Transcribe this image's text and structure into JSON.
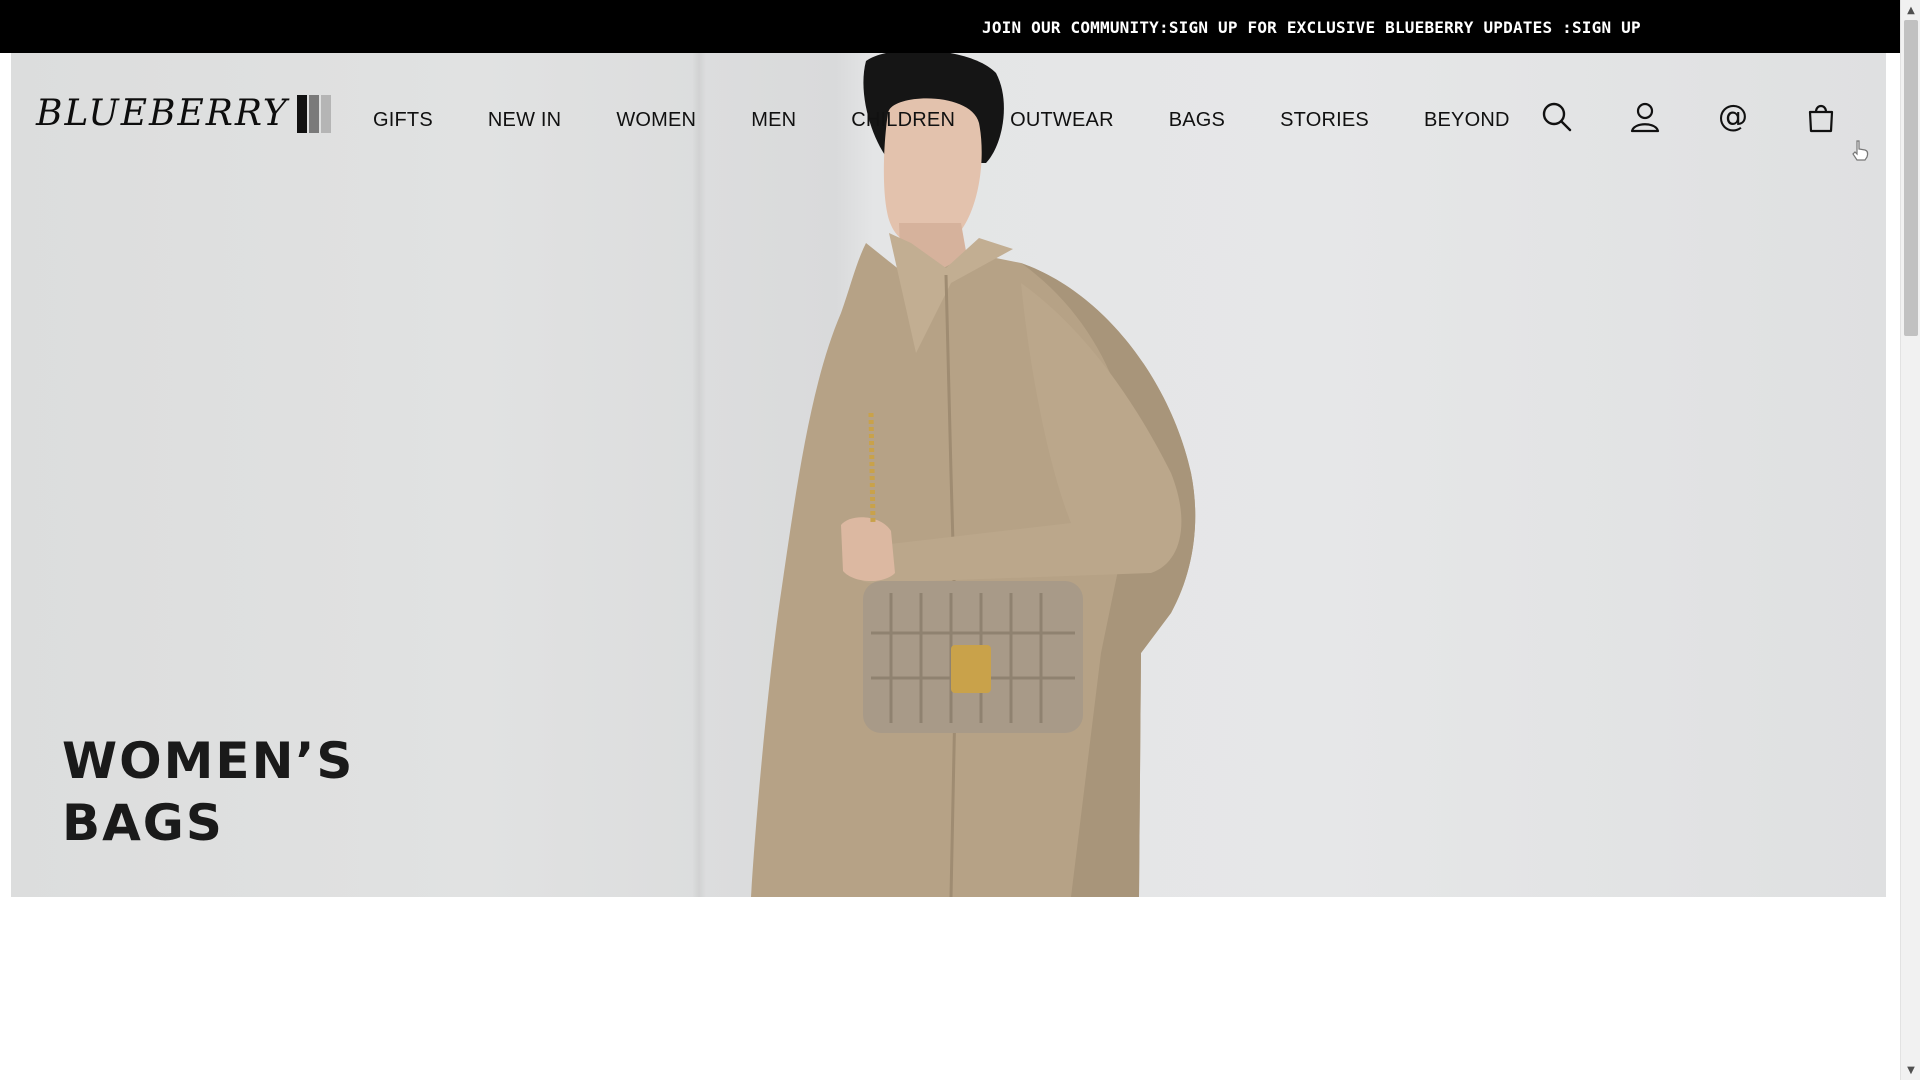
{
  "announcement": {
    "text": "JOIN OUR COMMUNITY:SIGN UP FOR EXCLUSIVE BLUEBERRY UPDATES :SIGN UP"
  },
  "header": {
    "logo_text": "BLUEBERRY",
    "nav": [
      {
        "label": "GIFTS"
      },
      {
        "label": "NEW IN"
      },
      {
        "label": "WOMEN"
      },
      {
        "label": "MEN"
      },
      {
        "label": "CHILDREN"
      },
      {
        "label": "OUTWEAR"
      },
      {
        "label": "BAGS"
      },
      {
        "label": "STORIES"
      },
      {
        "label": "BEYOND"
      }
    ],
    "icons": [
      "search-icon",
      "account-icon",
      "contact-at-icon",
      "shopping-bag-icon"
    ],
    "at_symbol": "@"
  },
  "hero": {
    "title_line1": "WOMEN’S",
    "title_line2": "BAGS"
  },
  "colors": {
    "announcement_bg": "#000000",
    "announcement_text": "#ffffff",
    "coat": "#b29f83",
    "bag": "#a89a88",
    "hardware": "#c9a24a"
  }
}
